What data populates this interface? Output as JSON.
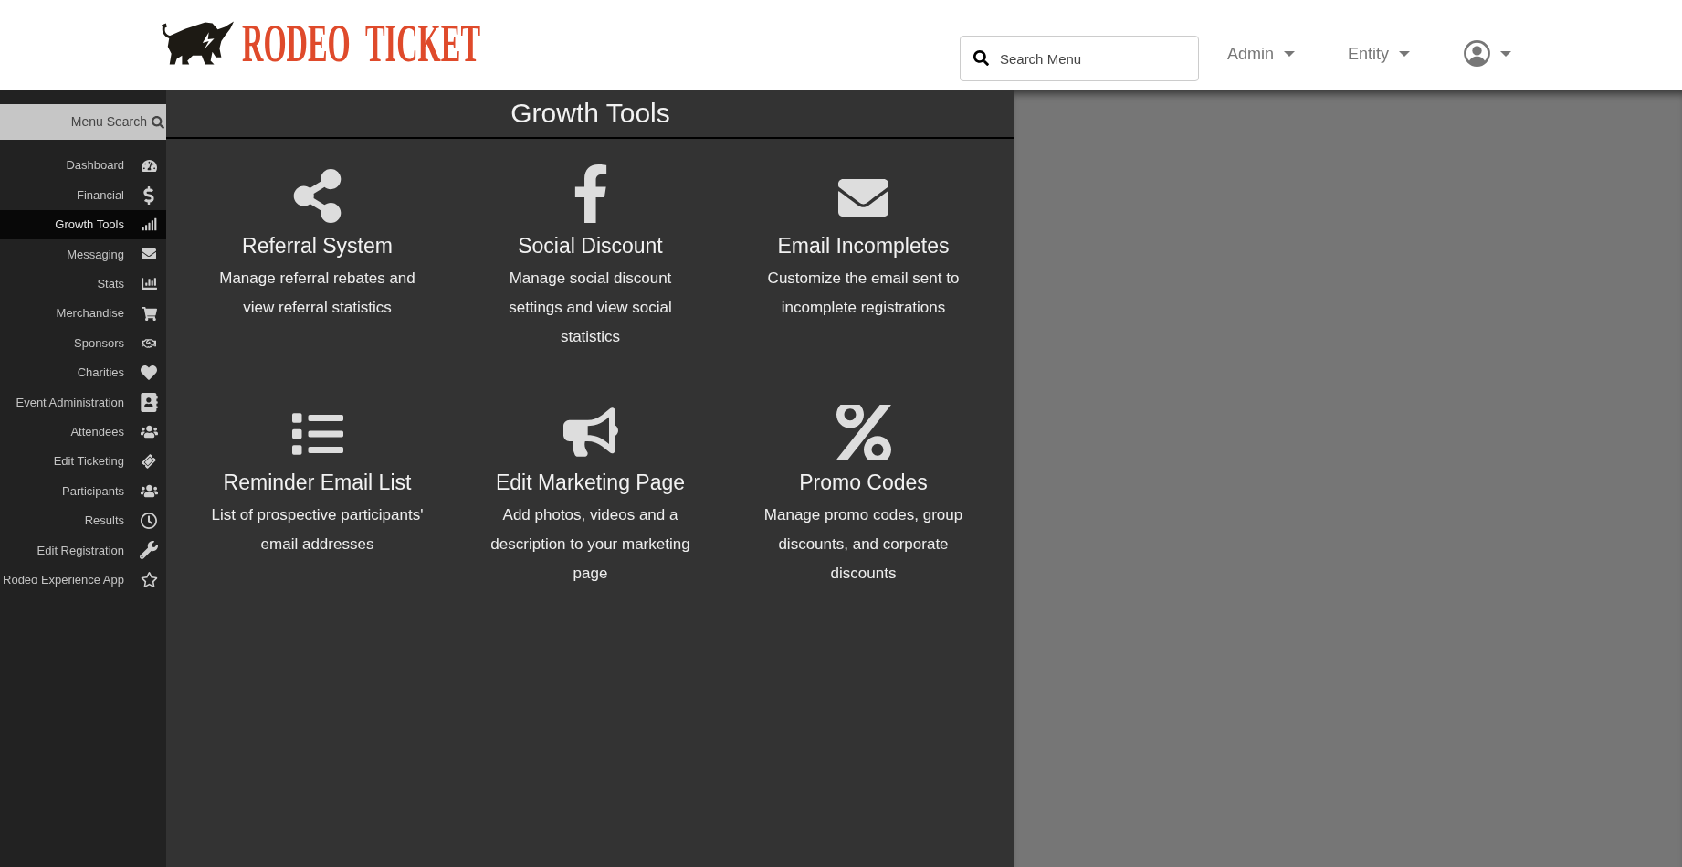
{
  "header": {
    "logo_text": "RODEO TICKET",
    "search": {
      "placeholder": "Search Menu"
    },
    "nav": [
      {
        "label": "Admin"
      },
      {
        "label": "Entity"
      }
    ]
  },
  "sidebar": {
    "search_label": "Menu Search",
    "items": [
      {
        "label": "Dashboard",
        "selected": false
      },
      {
        "label": "Financial",
        "selected": false
      },
      {
        "label": "Growth Tools",
        "selected": true
      },
      {
        "label": "Messaging",
        "selected": false
      },
      {
        "label": "Stats",
        "selected": false
      },
      {
        "label": "Merchandise",
        "selected": false
      },
      {
        "label": "Sponsors",
        "selected": false
      },
      {
        "label": "Charities",
        "selected": false
      },
      {
        "label": "Event Administration",
        "selected": false
      },
      {
        "label": "Attendees",
        "selected": false
      },
      {
        "label": "Edit Ticketing",
        "selected": false
      },
      {
        "label": "Participants",
        "selected": false
      },
      {
        "label": "Results",
        "selected": false
      },
      {
        "label": "Edit Registration",
        "selected": false
      },
      {
        "label": "Rodeo Experience App",
        "selected": false
      }
    ]
  },
  "main": {
    "title": "Growth Tools",
    "tools": [
      {
        "title": "Referral System",
        "description": "Manage referral rebates and view referral statistics"
      },
      {
        "title": "Social Discount",
        "description": "Manage social discount settings and view social statistics"
      },
      {
        "title": "Email Incompletes",
        "description": "Customize the email sent to incomplete registrations"
      },
      {
        "title": "Reminder Email List",
        "description": "List of prospective participants' email addresses"
      },
      {
        "title": "Edit Marketing Page",
        "description": "Add photos, videos and a description to your marketing page"
      },
      {
        "title": "Promo Codes",
        "description": "Manage promo codes, group discounts, and corporate discounts"
      }
    ]
  }
}
